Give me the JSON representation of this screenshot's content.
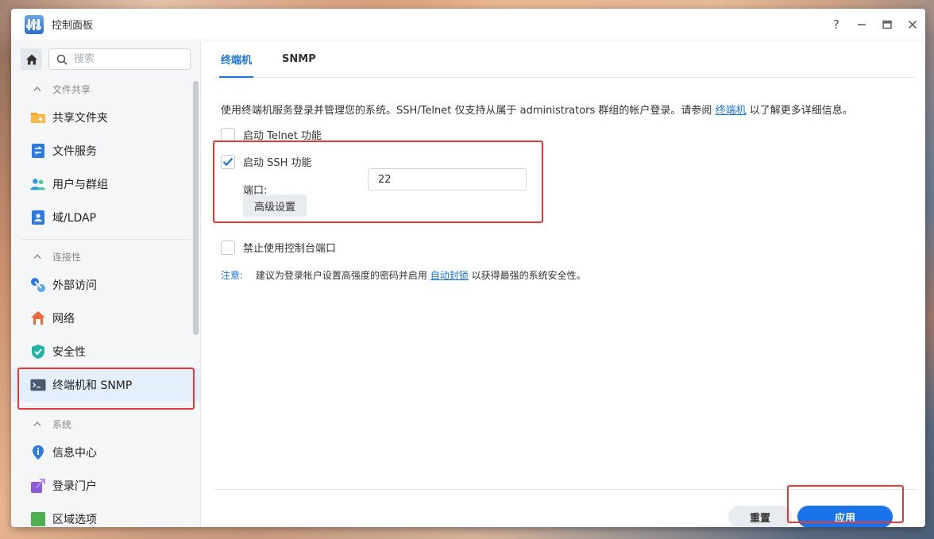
{
  "window": {
    "title": "控制面板",
    "help_label": "?"
  },
  "sidebar": {
    "search_placeholder": "搜索",
    "groups": [
      {
        "label": "文件共享"
      },
      {
        "label": "连接性"
      },
      {
        "label": "系统"
      }
    ],
    "items": [
      {
        "label": "共享文件夹"
      },
      {
        "label": "文件服务"
      },
      {
        "label": "用户与群组"
      },
      {
        "label": "域/LDAP"
      },
      {
        "label": "外部访问"
      },
      {
        "label": "网络"
      },
      {
        "label": "安全性"
      },
      {
        "label": "终端机和 SNMP"
      },
      {
        "label": "信息中心"
      },
      {
        "label": "登录门户"
      },
      {
        "label": "区域选项"
      }
    ]
  },
  "main": {
    "tabs": [
      {
        "label": "终端机"
      },
      {
        "label": "SNMP"
      }
    ],
    "description": {
      "text": "使用终端机服务登录并管理您的系统。SSH/Telnet 仅支持从属于 administrators 群组的帐户登录。请参阅",
      "link": "终端机",
      "suffix": "以了解更多详细信息。"
    },
    "telnet_label": "启动 Telnet 功能",
    "ssh_label": "启动 SSH 功能",
    "port_label": "端口:",
    "port_value": "22",
    "advanced_button": "高级设置",
    "console_label": "禁止使用控制台端口",
    "note": {
      "label": "注意:",
      "text": "建议为登录帐户设置高强度的密码并启用",
      "link": "自动封锁",
      "suffix": "以获得最强的系统安全性。"
    }
  },
  "footer": {
    "reset_label": "重置",
    "apply_label": "应用"
  },
  "colors": {
    "accent": "#1a73e8",
    "highlight_box": "#e53935",
    "active_item_bg": "#e5effb"
  }
}
